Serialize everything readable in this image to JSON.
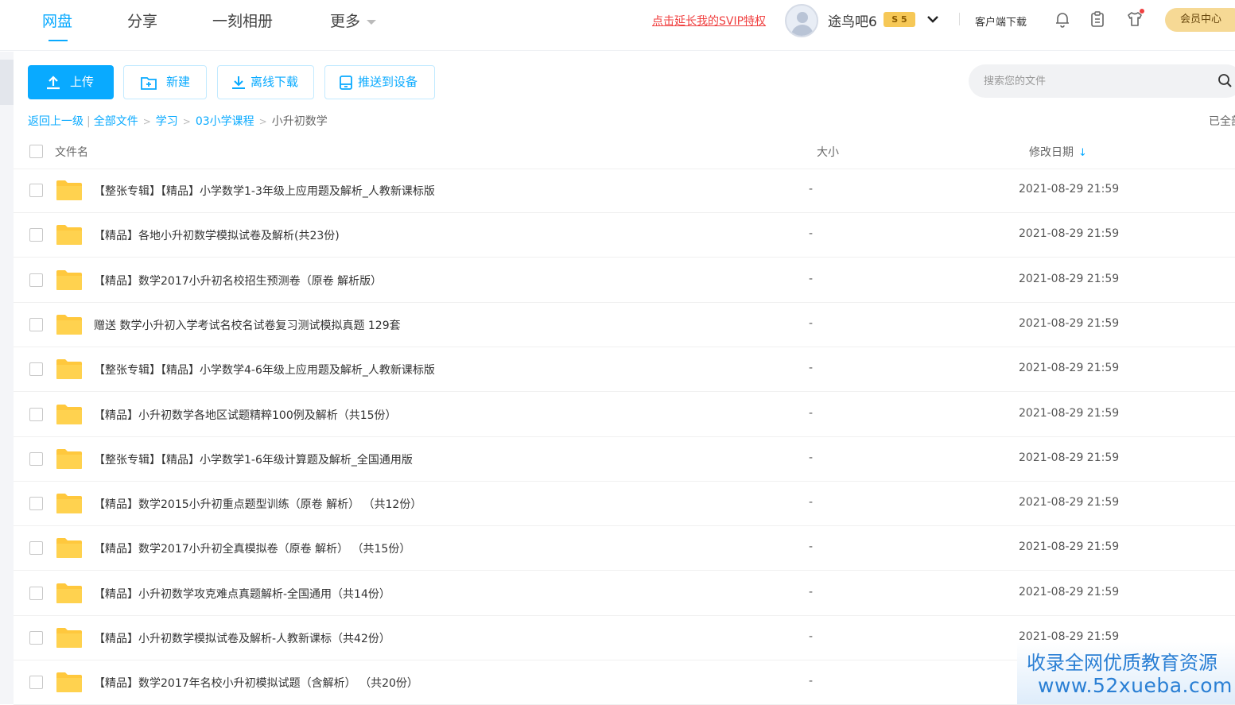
{
  "nav": {
    "tabs": [
      {
        "label": "网盘",
        "active": true
      },
      {
        "label": "分享",
        "active": false
      },
      {
        "label": "一刻相册",
        "active": false
      },
      {
        "label": "更多",
        "active": false
      }
    ],
    "svip_link": "点击延长我的SVIP特权",
    "username": "途鸟吧6",
    "vip_level": "5",
    "client_download": "客户端下载",
    "member_center": "会员中心",
    "accent_color": "#09aaff"
  },
  "toolbar": {
    "upload": "上传",
    "new": "新建",
    "offline_download": "离线下载",
    "push_to_device": "推送到设备",
    "search_placeholder": "搜索您的文件"
  },
  "breadcrumb": {
    "back": "返回上一级",
    "all_files": "全部文件",
    "items": [
      "学习",
      "03小学课程"
    ],
    "current": "小升初数学",
    "status": "已全部加载"
  },
  "table": {
    "columns": {
      "name": "文件名",
      "size": "大小",
      "modified": "修改日期"
    },
    "rows": [
      {
        "name": "【整张专辑】【精品】小学数学1-3年级上应用题及解析_人教新课标版",
        "size": "-",
        "modified": "2021-08-29 21:59"
      },
      {
        "name": "【精品】各地小升初数学模拟试卷及解析(共23份)",
        "size": "-",
        "modified": "2021-08-29 21:59"
      },
      {
        "name": "【精品】数学2017小升初名校招生预测卷（原卷 解析版）",
        "size": "-",
        "modified": "2021-08-29 21:59"
      },
      {
        "name": "赠送 数学小升初入学考试名校名试卷复习测试模拟真题 129套",
        "size": "-",
        "modified": "2021-08-29 21:59"
      },
      {
        "name": "【整张专辑】【精品】小学数学4-6年级上应用题及解析_人教新课标版",
        "size": "-",
        "modified": "2021-08-29 21:59"
      },
      {
        "name": "【精品】小升初数学各地区试题精粹100例及解析（共15份）",
        "size": "-",
        "modified": "2021-08-29 21:59"
      },
      {
        "name": "【整张专辑】【精品】小学数学1-6年级计算题及解析_全国通用版",
        "size": "-",
        "modified": "2021-08-29 21:59"
      },
      {
        "name": "【精品】数学2015小升初重点题型训练（原卷 解析） （共12份）",
        "size": "-",
        "modified": "2021-08-29 21:59"
      },
      {
        "name": "【精品】数学2017小升初全真模拟卷（原卷 解析） （共15份）",
        "size": "-",
        "modified": "2021-08-29 21:59"
      },
      {
        "name": "【精品】小升初数学攻克难点真题解析-全国通用（共14份）",
        "size": "-",
        "modified": "2021-08-29 21:59"
      },
      {
        "name": "【精品】小升初数学模拟试卷及解析-人教新课标（共42份）",
        "size": "-",
        "modified": "2021-08-29 21:59"
      },
      {
        "name": "【精品】数学2017年名校小升初模拟试题（含解析） （共20份）",
        "size": "-",
        "modified": ""
      }
    ]
  },
  "watermark": {
    "line1": "收录全网优质教育资源",
    "line2": "www.52xueba.com"
  }
}
